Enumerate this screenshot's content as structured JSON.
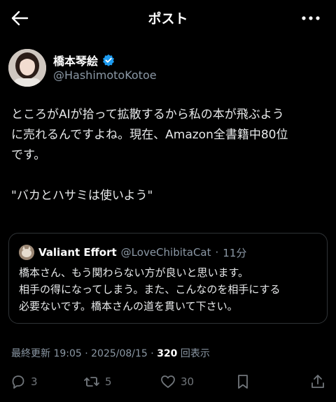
{
  "header": {
    "title": "ポスト",
    "back_icon": "arrow-left-icon",
    "more_icon": "more-horizontal-icon"
  },
  "author": {
    "name": "橋本琴絵",
    "handle": "@HashimotoKotoe",
    "verified": true,
    "verified_color": "#1d9bf0"
  },
  "post": {
    "lines": [
      "ところがAIが拾って拡散するから私の本が飛ぶよう",
      "に売れるんですよね。現在、Amazon全書籍中80位",
      "です。",
      "",
      "\"バカとハサミは使いよう\""
    ]
  },
  "quote": {
    "name": "Valiant Effort",
    "handle": "@LoveChibitaCat",
    "separator": "·",
    "time": "11分",
    "lines": [
      "橋本さん、もう関わらない方が良いと思います。",
      "相手の得になってしまう。また、こんなのを相手にする",
      "必要ないです。橋本さんの道を貫いて下さい。"
    ]
  },
  "meta": {
    "prefix": "最終更新 19:05 · 2025/08/15 · ",
    "views_count": "320",
    "views_label": " 回表示"
  },
  "actions": {
    "replies": "3",
    "reposts": "5",
    "likes": "30",
    "icon_color": "#71767b"
  }
}
